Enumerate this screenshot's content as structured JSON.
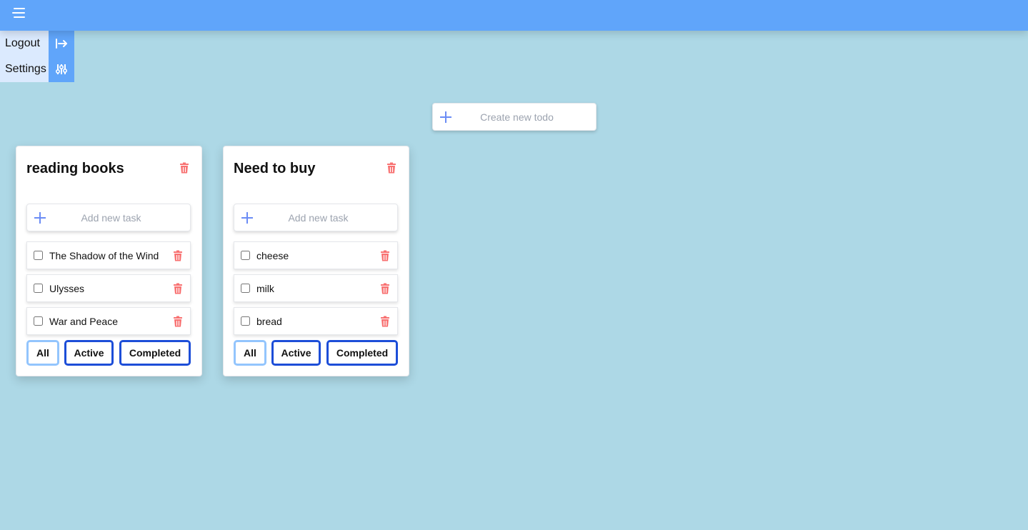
{
  "header": {
    "menu_icon": "hamburger-menu-icon",
    "color": "#60a5fa"
  },
  "side_menu": {
    "items": [
      {
        "label": "Logout",
        "icon": "logout-arrow-icon"
      },
      {
        "label": "Settings",
        "icon": "sliders-icon"
      }
    ]
  },
  "create_todo": {
    "placeholder": "Create new todo",
    "icon": "plus-icon"
  },
  "todo_lists": [
    {
      "title": "reading books",
      "add_task_placeholder": "Add new task",
      "tasks": [
        {
          "text": "The Shadow of the Wind",
          "done": false
        },
        {
          "text": "Ulysses",
          "done": false
        },
        {
          "text": "War and Peace",
          "done": false
        }
      ],
      "filters": [
        "All",
        "Active",
        "Completed"
      ],
      "selected_filter": "All"
    },
    {
      "title": "Need to buy",
      "add_task_placeholder": "Add new task",
      "tasks": [
        {
          "text": "cheese",
          "done": false
        },
        {
          "text": "milk",
          "done": false
        },
        {
          "text": "bread",
          "done": false
        }
      ],
      "filters": [
        "All",
        "Active",
        "Completed"
      ],
      "selected_filter": "All"
    }
  ],
  "colors": {
    "background": "#add8e6",
    "accent": "#60a5fa",
    "delete": "#f87171",
    "filter_border": "#1d4ed8",
    "filter_selected_border": "#93c5fd"
  }
}
